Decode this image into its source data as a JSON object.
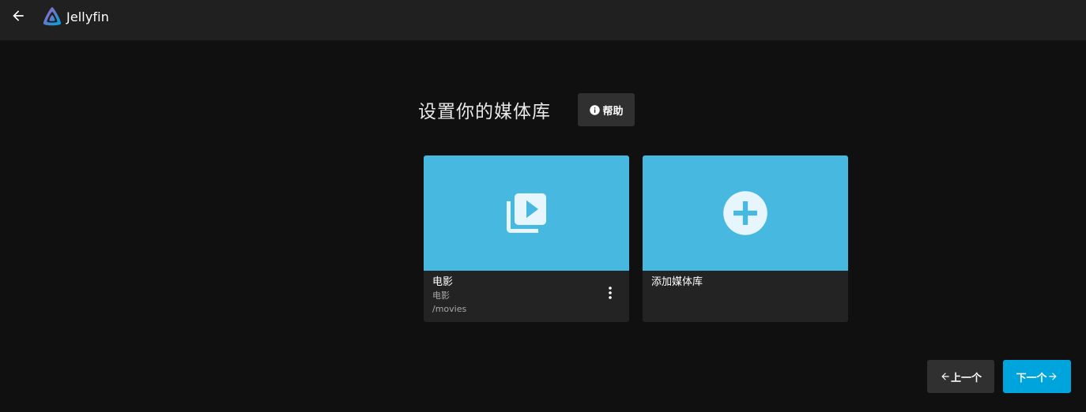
{
  "header": {
    "app_name": "Jellyfin",
    "back_icon": "arrow-left-icon",
    "logo_icon": "jellyfin-logo-icon"
  },
  "main": {
    "title": "设置你的媒体库",
    "help_label": "帮助",
    "help_icon": "info-icon"
  },
  "libraries": [
    {
      "title": "电影",
      "type": "电影",
      "path": "/movies",
      "icon": "video-library-icon"
    }
  ],
  "add_library": {
    "label": "添加媒体库",
    "icon": "add-circle-icon"
  },
  "nav": {
    "prev_label": "上一个",
    "next_label": "下一个"
  },
  "colors": {
    "header_bg": "#202020",
    "page_bg": "#101010",
    "card_image_bg": "#47b9e1",
    "accent": "#00a4dc"
  }
}
